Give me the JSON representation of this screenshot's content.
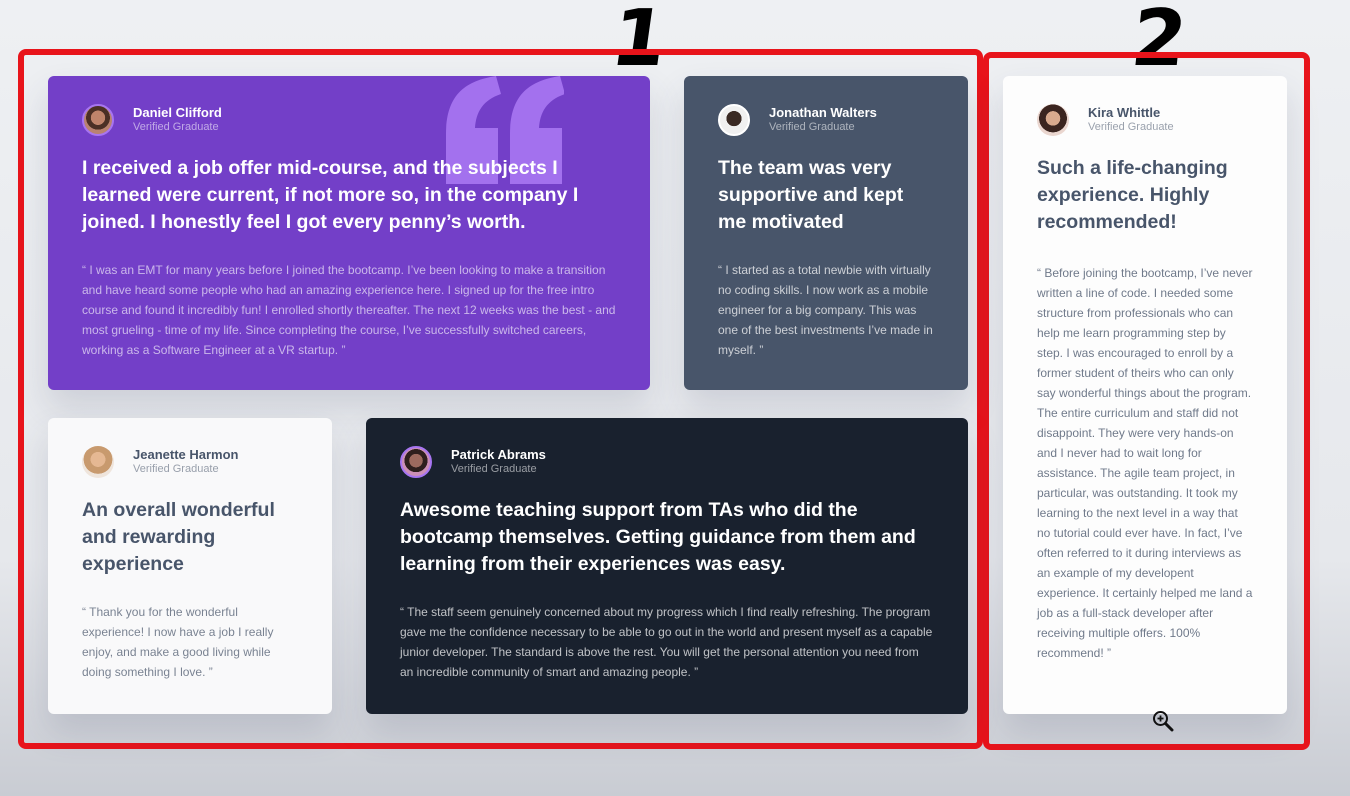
{
  "annotations": {
    "label_1": "1",
    "label_2": "2",
    "frame_color": "#e8141b"
  },
  "colors": {
    "purple": "#733fc8",
    "slate": "#48556a",
    "white": "#ffffff",
    "dark": "#19212e",
    "quote": "#a775f1"
  },
  "testimonials": [
    {
      "name": "Daniel Clifford",
      "role": "Verified Graduate",
      "headline": "I received a job offer mid-course, and the subjects I learned were current, if not more so, in the company I joined. I honestly feel I got every penny’s worth.",
      "body": "“ I was an EMT for many years before I joined the bootcamp. I’ve been looking to make a transition and have heard some people who had an amazing experience here. I signed up for the free intro course and found it incredibly fun! I enrolled shortly thereafter. The next 12 weeks was the  best - and most grueling - time of my life. Since completing the course, I’ve successfully switched careers, working as a Software Engineer at a VR startup. ”",
      "avatar_icon": "avatar-icon"
    },
    {
      "name": "Jonathan Walters",
      "role": "Verified Graduate",
      "headline": "The team was very supportive and kept me motivated",
      "body": "“ I started as a total newbie with virtually no coding skills. I now work as a mobile engineer for a big company. This was one of the best investments I’ve made in myself. ”",
      "avatar_icon": "avatar-icon"
    },
    {
      "name": "Jeanette Harmon",
      "role": "Verified Graduate",
      "headline": "An overall wonderful and rewarding experience",
      "body": "“ Thank you for the wonderful experience! I now have a job I really enjoy, and make a good living while doing something I love. ”",
      "avatar_icon": "avatar-icon"
    },
    {
      "name": "Patrick Abrams",
      "role": "Verified Graduate",
      "headline": "Awesome teaching support from TAs who did the bootcamp themselves. Getting guidance from them and learning from their experiences was easy.",
      "body": "“ The staff seem genuinely concerned about my progress which I find really refreshing. The program gave me the confidence necessary to be able to go out in the world and present myself as a capable junior developer. The standard is above the rest. You will get the personal attention you need from an incredible community of smart and amazing people. ”",
      "avatar_icon": "avatar-icon"
    },
    {
      "name": "Kira Whittle",
      "role": "Verified Graduate",
      "headline": "Such a life-changing experience. Highly recommended!",
      "body": "“ Before joining the bootcamp, I’ve never written a line of code. I needed some structure from professionals who can help me learn programming step by step. I was encouraged to enroll by a former student of theirs who can only say wonderful things about the program. The entire curriculum and staff did not disappoint. They were very hands-on and I never had to wait long for assistance. The agile team project, in particular, was outstanding. It took my learning to the next level in a way that no tutorial could ever have. In fact, I’ve often referred to it during interviews as an example of my developent experience. It certainly helped me land a job as a full-stack developer after receiving multiple offers. 100% recommend! ”",
      "avatar_icon": "avatar-icon"
    }
  ],
  "cursor_icon": "zoom-in-icon"
}
